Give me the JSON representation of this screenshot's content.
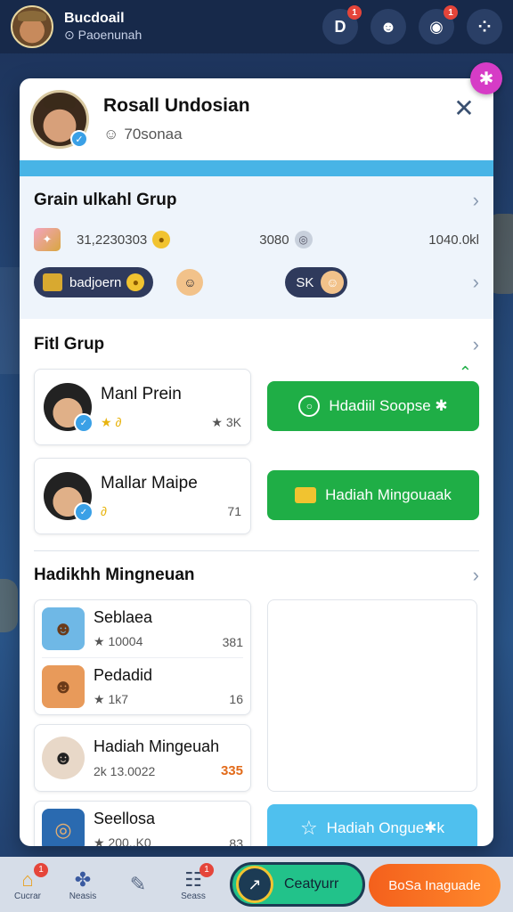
{
  "topbar": {
    "name": "Bucdoail",
    "sub": "⊙ Paoenunah",
    "icons": [
      {
        "icon": "d-icon",
        "glyph": "D",
        "badge": "1"
      },
      {
        "icon": "smile-icon",
        "glyph": "☻",
        "badge": ""
      },
      {
        "icon": "chat-icon",
        "glyph": "◉",
        "badge": "1"
      },
      {
        "icon": "grid-icon",
        "glyph": "⁘",
        "badge": ""
      }
    ]
  },
  "profile": {
    "name": "Rosall Undosian",
    "sub": "70sonaa"
  },
  "group": {
    "title": "Grain ulkahl Grup",
    "stat1": "31,2230303",
    "stat2": "3080",
    "stat3": "1040.0kl",
    "chip1": "badjoern",
    "chip2": "SK"
  },
  "members": {
    "title": "Fitl Grup",
    "items": [
      {
        "name": "Manl Prein",
        "left": "★ ∂",
        "right": "★ 3K"
      },
      {
        "name": "Mallar Maipe",
        "left": "∂",
        "right": "71"
      }
    ],
    "btn1": "Hdadiil Soopse ✱",
    "btn2": "Hadiah Mingouaak"
  },
  "weekly": {
    "title": "Hadikhh Mingneuan",
    "list1": [
      {
        "name": "Seblaea",
        "left": "★ 10004",
        "right": "381"
      },
      {
        "name": "Pedadid",
        "left": "★ 1k7",
        "right": "16"
      }
    ],
    "list2": [
      {
        "name": "Hadiah Mingeuah",
        "left": "2k 13.0022",
        "right": "335"
      }
    ],
    "list3": [
      {
        "name": "Seellosa",
        "left": "★ 200..K0",
        "right": "83"
      }
    ],
    "btn": "Hadiah Ongue✱k"
  },
  "bottomnav": {
    "items": [
      {
        "label": "Cucrar",
        "badge": "1"
      },
      {
        "label": "Neasis",
        "badge": ""
      },
      {
        "label": "",
        "badge": ""
      },
      {
        "label": "Seass",
        "badge": "1"
      }
    ],
    "pill": "Ceatyurr",
    "orange": "BoSa Inaguade"
  },
  "colors": {
    "accent_green": "#1fae46",
    "accent_blue": "#4fc0ee",
    "accent_orange": "#f4601c",
    "badge_red": "#e5453a"
  }
}
